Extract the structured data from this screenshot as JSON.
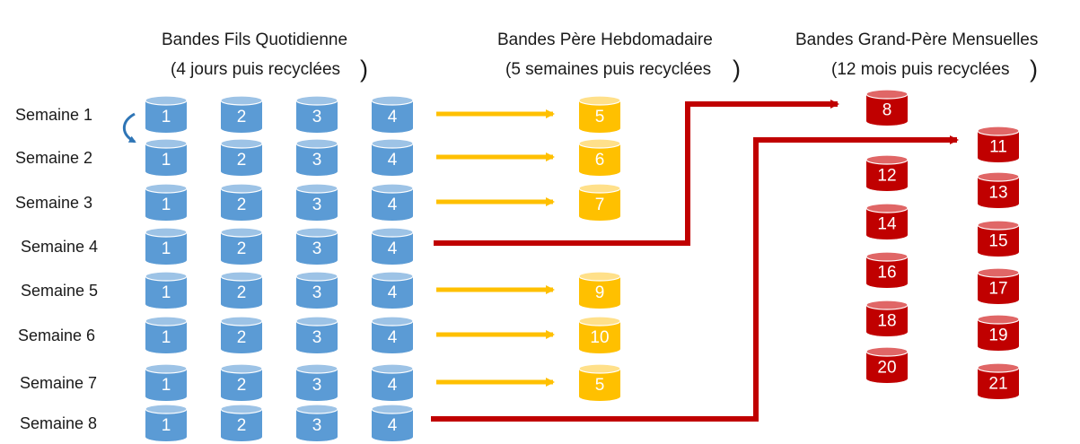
{
  "headers": {
    "son": {
      "title": "Bandes Fils  Quotidienne",
      "subtitle": "(4 jours puis recyclées",
      "close": ")"
    },
    "father": {
      "title": "Bandes Père  Hebdomadaire",
      "subtitle": "(5 semaines puis recyclées",
      "close": ")"
    },
    "grandfather": {
      "title": "Bandes Grand-Père  Mensuelles",
      "subtitle": "(12 mois puis recyclées",
      "close": ")"
    }
  },
  "weeks": [
    {
      "label": "Semaine 1",
      "daily": [
        "1",
        "2",
        "3",
        "4"
      ],
      "weekly": "5",
      "flow": "weekly"
    },
    {
      "label": "Semaine 2",
      "daily": [
        "1",
        "2",
        "3",
        "4"
      ],
      "weekly": "6",
      "flow": "weekly"
    },
    {
      "label": "Semaine 3",
      "daily": [
        "1",
        "2",
        "3",
        "4"
      ],
      "weekly": "7",
      "flow": "weekly"
    },
    {
      "label": "Semaine 4",
      "daily": [
        "1",
        "2",
        "3",
        "4"
      ],
      "weekly": "",
      "flow": "monthly",
      "monthly_target": "8"
    },
    {
      "label": "Semaine 5",
      "daily": [
        "1",
        "2",
        "3",
        "4"
      ],
      "weekly": "9",
      "flow": "weekly"
    },
    {
      "label": "Semaine 6",
      "daily": [
        "1",
        "2",
        "3",
        "4"
      ],
      "weekly": "10",
      "flow": "weekly"
    },
    {
      "label": "Semaine 7",
      "daily": [
        "1",
        "2",
        "3",
        "4"
      ],
      "weekly": "5",
      "flow": "weekly"
    },
    {
      "label": "Semaine 8",
      "daily": [
        "1",
        "2",
        "3",
        "4"
      ],
      "weekly": "",
      "flow": "monthly",
      "monthly_target": "11"
    }
  ],
  "monthly": {
    "column_a": [
      "8",
      "12",
      "14",
      "16",
      "18",
      "20"
    ],
    "column_b": [
      "11",
      "13",
      "15",
      "17",
      "19",
      "21"
    ]
  },
  "colors": {
    "daily_body": "#5b9bd5",
    "daily_top": "#9dc3e6",
    "weekly_body": "#ffc000",
    "weekly_top": "#ffe08a",
    "monthly_body": "#c00000",
    "monthly_top": "#e06666",
    "weekly_arrow": "#ffc000",
    "monthly_arrow": "#c00000",
    "rotate_arrow": "#2e75b6"
  }
}
